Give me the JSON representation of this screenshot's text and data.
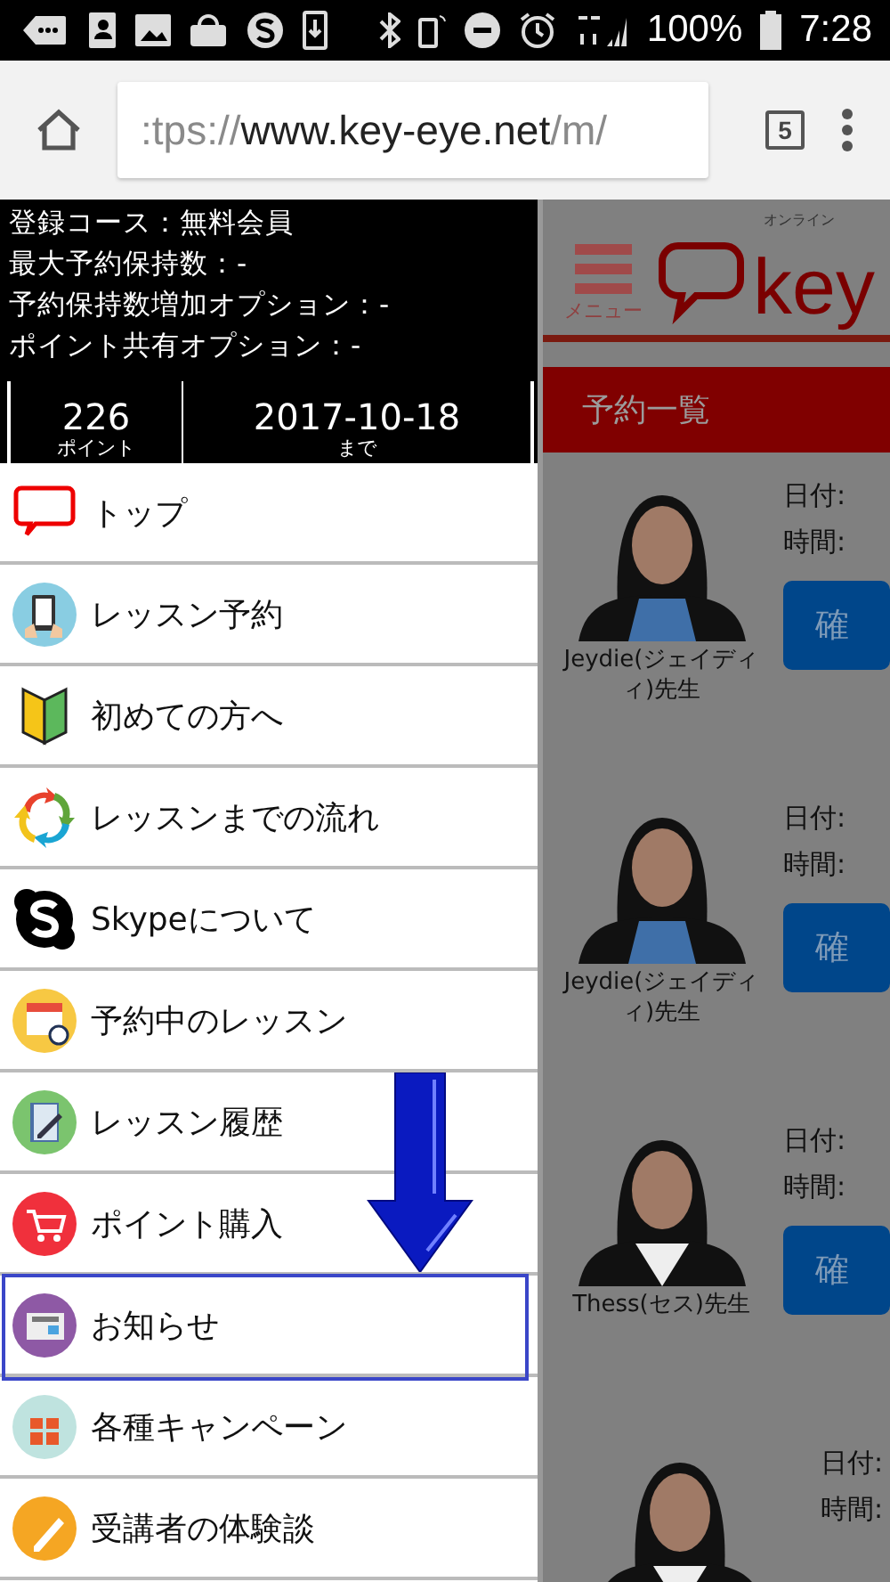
{
  "status_bar": {
    "battery": "100%",
    "time": "7:28"
  },
  "browser": {
    "url_parts": [
      {
        "text": ":tps://",
        "kind": "faded"
      },
      {
        "text": "www.key-eye.net",
        "kind": "host"
      },
      {
        "text": "/m/",
        "kind": "faded"
      }
    ],
    "tab_count": "5"
  },
  "account": {
    "lines": [
      "登録コース：無料会員",
      "最大予約保持数：-",
      "予約保持数増加オプション：-",
      "ポイント共有オプション：-"
    ],
    "points": "226",
    "points_label": "ポイント",
    "expiry": "2017-10-18",
    "expiry_label": "まで"
  },
  "menu": {
    "items": [
      {
        "label": "トップ",
        "highlighted": false
      },
      {
        "label": "レッスン予約",
        "highlighted": false
      },
      {
        "label": "初めての方へ",
        "highlighted": false
      },
      {
        "label": "レッスンまでの流れ",
        "highlighted": false
      },
      {
        "label": "Skypeについて",
        "highlighted": false
      },
      {
        "label": "予約中のレッスン",
        "highlighted": false
      },
      {
        "label": "レッスン履歴",
        "highlighted": false
      },
      {
        "label": "ポイント購入",
        "highlighted": false
      },
      {
        "label": "お知らせ",
        "highlighted": true
      },
      {
        "label": "各種キャンペーン",
        "highlighted": false
      },
      {
        "label": "受講者の体験談",
        "highlighted": false
      }
    ]
  },
  "background_page": {
    "menu_label": "メニュー",
    "logo_caption": "オンライン",
    "logo_text": "key",
    "section_title": "予約一覧",
    "lessons": [
      {
        "teacher": "Jeydie(ジェイディィ)先生",
        "date_label": "日付:",
        "time_label": "時間:",
        "button": "確"
      },
      {
        "teacher": "Jeydie(ジェイディィ)先生",
        "date_label": "日付:",
        "time_label": "時間:",
        "button": "確"
      },
      {
        "teacher": "Thess(セス)先生",
        "date_label": "日付:",
        "time_label": "時間:",
        "button": "確"
      },
      {
        "date_label": "日付:",
        "time_label": "時間:"
      }
    ]
  }
}
